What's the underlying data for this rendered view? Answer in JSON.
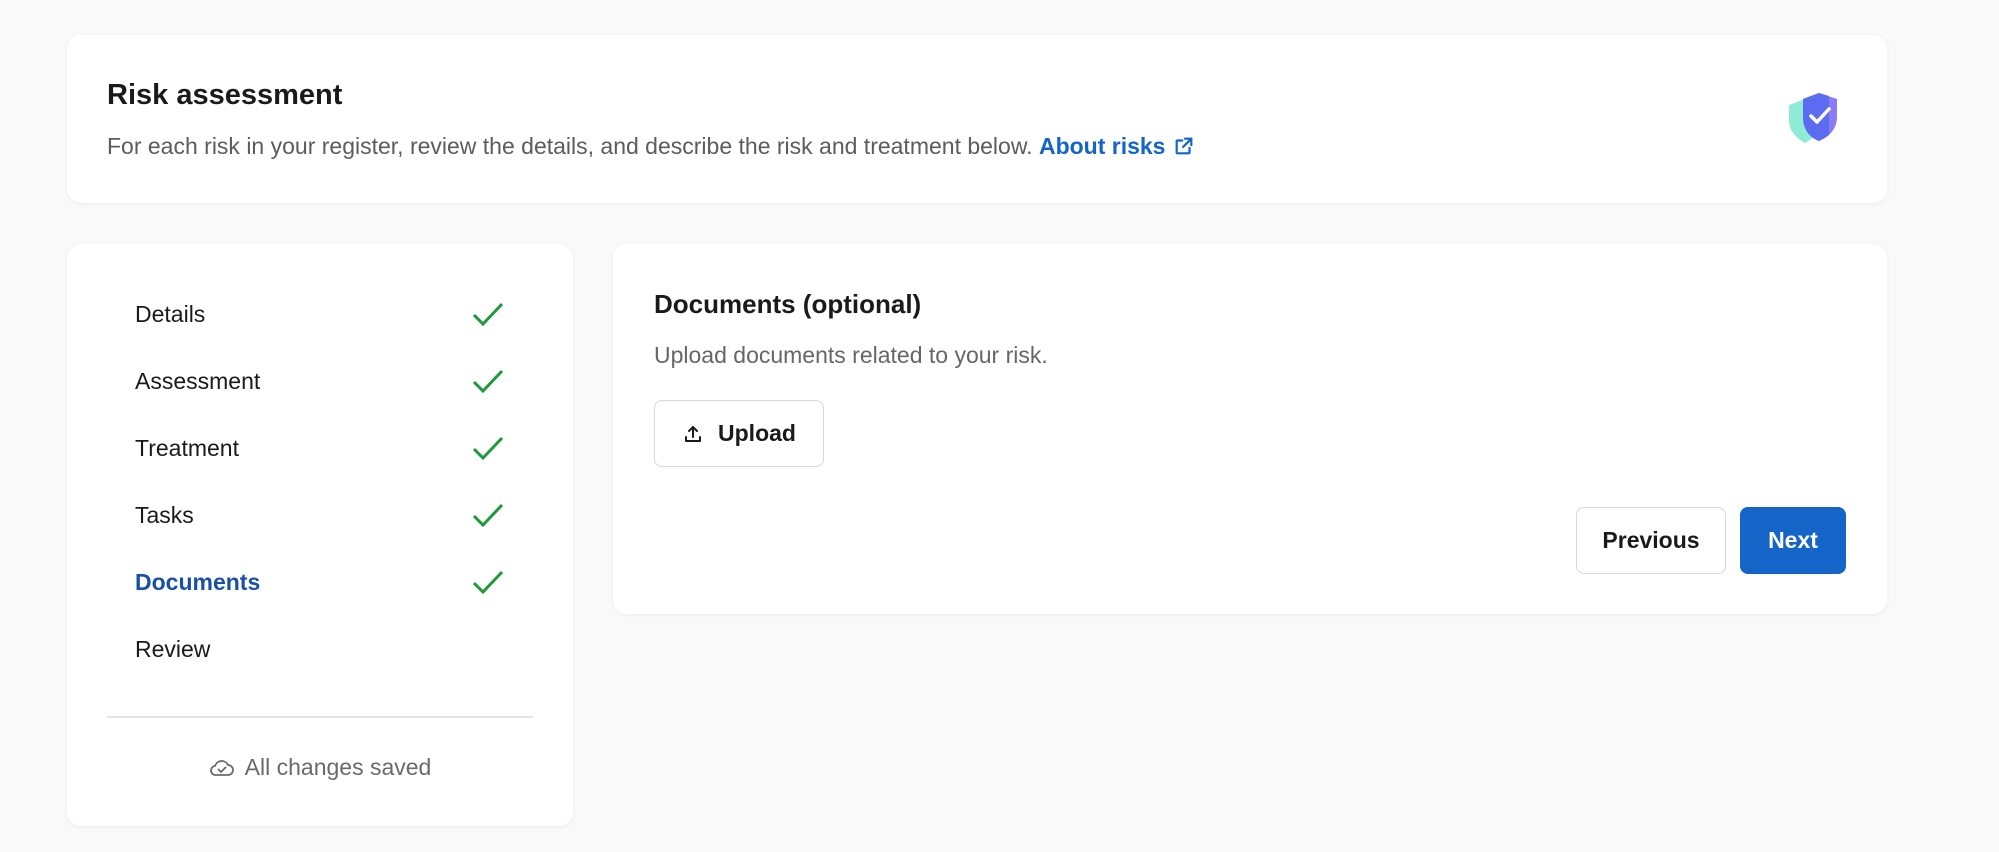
{
  "header": {
    "title": "Risk assessment",
    "description": "For each risk in your register, review the details, and describe the risk and treatment below.",
    "link_label": "About risks",
    "link_icon": "external-link-icon",
    "badge_icon": "shield-check-icon"
  },
  "steps": {
    "items": [
      {
        "label": "Details",
        "completed": true,
        "active": false
      },
      {
        "label": "Assessment",
        "completed": true,
        "active": false
      },
      {
        "label": "Treatment",
        "completed": true,
        "active": false
      },
      {
        "label": "Tasks",
        "completed": true,
        "active": false
      },
      {
        "label": "Documents",
        "completed": true,
        "active": true
      },
      {
        "label": "Review",
        "completed": false,
        "active": false
      }
    ],
    "status": "All changes saved",
    "status_icon": "cloud-check-icon"
  },
  "main": {
    "heading": "Documents (optional)",
    "subtext": "Upload documents related to your risk.",
    "upload_label": "Upload",
    "previous_label": "Previous",
    "next_label": "Next"
  },
  "colors": {
    "accent": "#1564c8",
    "active_step": "#1a4fa8",
    "check": "#1e9a3c",
    "background": "#f9f9f9"
  }
}
